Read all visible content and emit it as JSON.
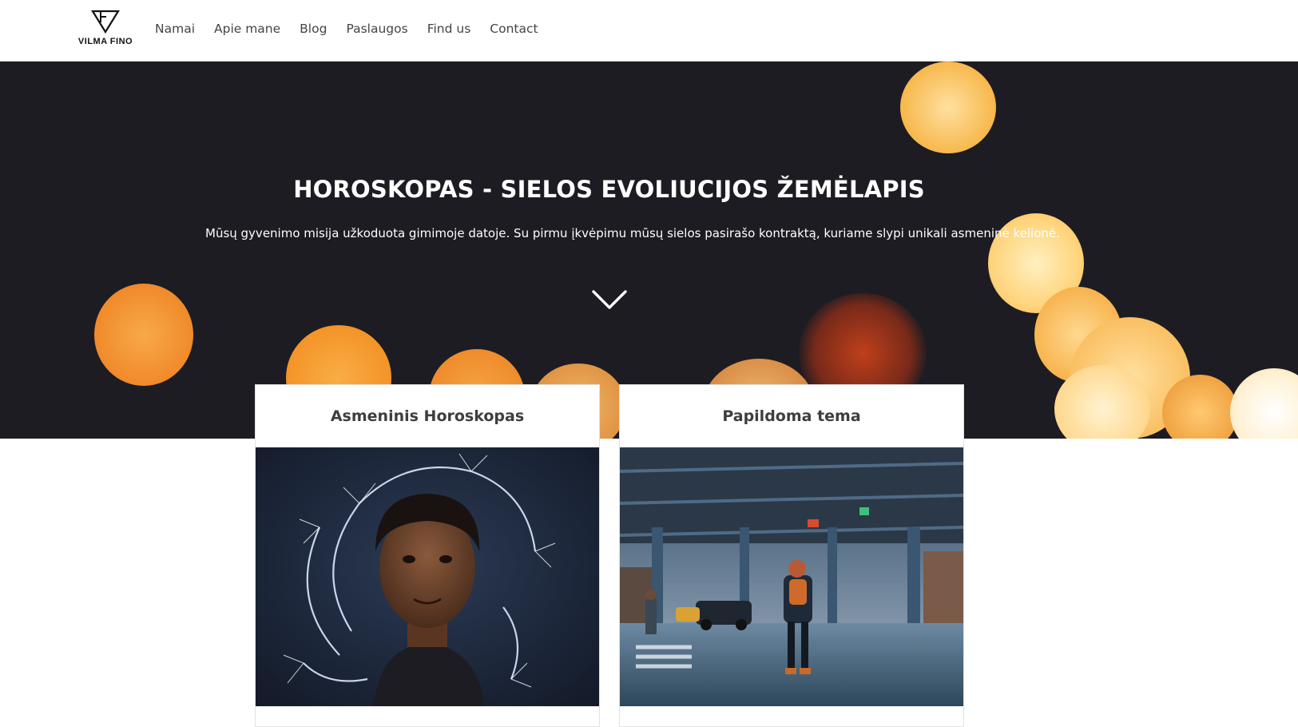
{
  "brand": {
    "logo_text": "VILMA FINO"
  },
  "nav": {
    "items": [
      {
        "label": "Namai"
      },
      {
        "label": "Apie mane"
      },
      {
        "label": "Blog"
      },
      {
        "label": "Paslaugos"
      },
      {
        "label": "Find us"
      },
      {
        "label": "Contact"
      }
    ]
  },
  "hero": {
    "title": "HOROSKOPAS - SIELOS EVOLIUCIJOS ŽEMĖLAPIS",
    "subtitle": "Mūsų gyvenimo misija užkoduota gimimoje datoje. Su pirmu įkvėpimu mūsų sielos pasirašo kontraktą, kuriame slypi unikali asmeninė kelionė.",
    "scroll_icon": "chevron-down-icon"
  },
  "cards": [
    {
      "title": "Asmeninis Horoskopas",
      "image": "sparkler-portrait-photo"
    },
    {
      "title": "Papildoma tema",
      "image": "city-street-under-bridge-photo"
    }
  ],
  "colors": {
    "hero_bg": "#1d1c22",
    "bokeh_orange": "#f29a2e",
    "bokeh_light": "#ffd27a",
    "text_dark": "#3e3e3e",
    "nav_text": "#444444"
  }
}
